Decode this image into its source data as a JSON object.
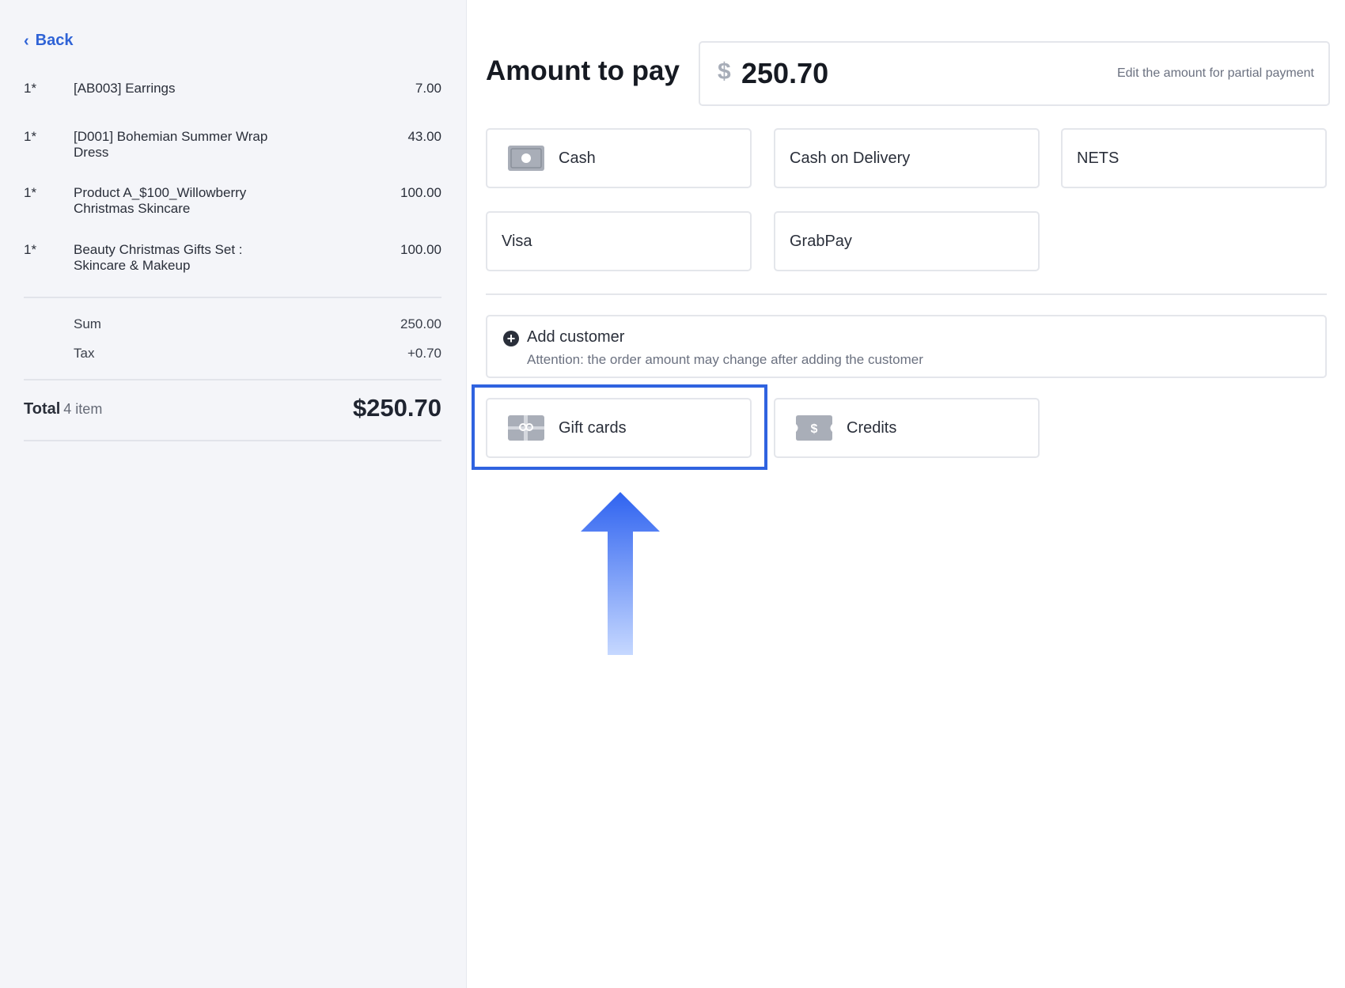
{
  "nav": {
    "back_label": "Back"
  },
  "order": {
    "items": [
      {
        "qty": "1*",
        "name": "[AB003] Earrings",
        "price": "7.00"
      },
      {
        "qty": "1*",
        "name": "[D001] Bohemian Summer Wrap Dress",
        "price": "43.00"
      },
      {
        "qty": "1*",
        "name": "Product A_$100_Willowberry Christmas Skincare",
        "price": "100.00"
      },
      {
        "qty": "1*",
        "name": "Beauty Christmas Gifts Set : Skincare & Makeup",
        "price": "100.00"
      }
    ],
    "sum_label": "Sum",
    "sum_value": "250.00",
    "tax_label": "Tax",
    "tax_value": "+0.70",
    "total_label": "Total",
    "total_count": "4 item",
    "total_value": "$250.70"
  },
  "payment": {
    "title": "Amount to pay",
    "currency_symbol": "$",
    "amount": "250.70",
    "amount_hint": "Edit the amount for partial payment",
    "methods": [
      {
        "label": "Cash",
        "icon": "cash-icon"
      },
      {
        "label": "Cash on Delivery"
      },
      {
        "label": "NETS"
      },
      {
        "label": "Visa"
      },
      {
        "label": "GrabPay"
      }
    ],
    "customer": {
      "title": "Add customer",
      "note": "Attention: the order amount may change after adding the customer"
    },
    "extras": [
      {
        "label": "Gift cards",
        "icon": "gift-card-icon"
      },
      {
        "label": "Credits",
        "icon": "credits-icon"
      }
    ]
  },
  "colors": {
    "accent": "#2f63e0",
    "panel_bg": "#f4f5f9"
  }
}
